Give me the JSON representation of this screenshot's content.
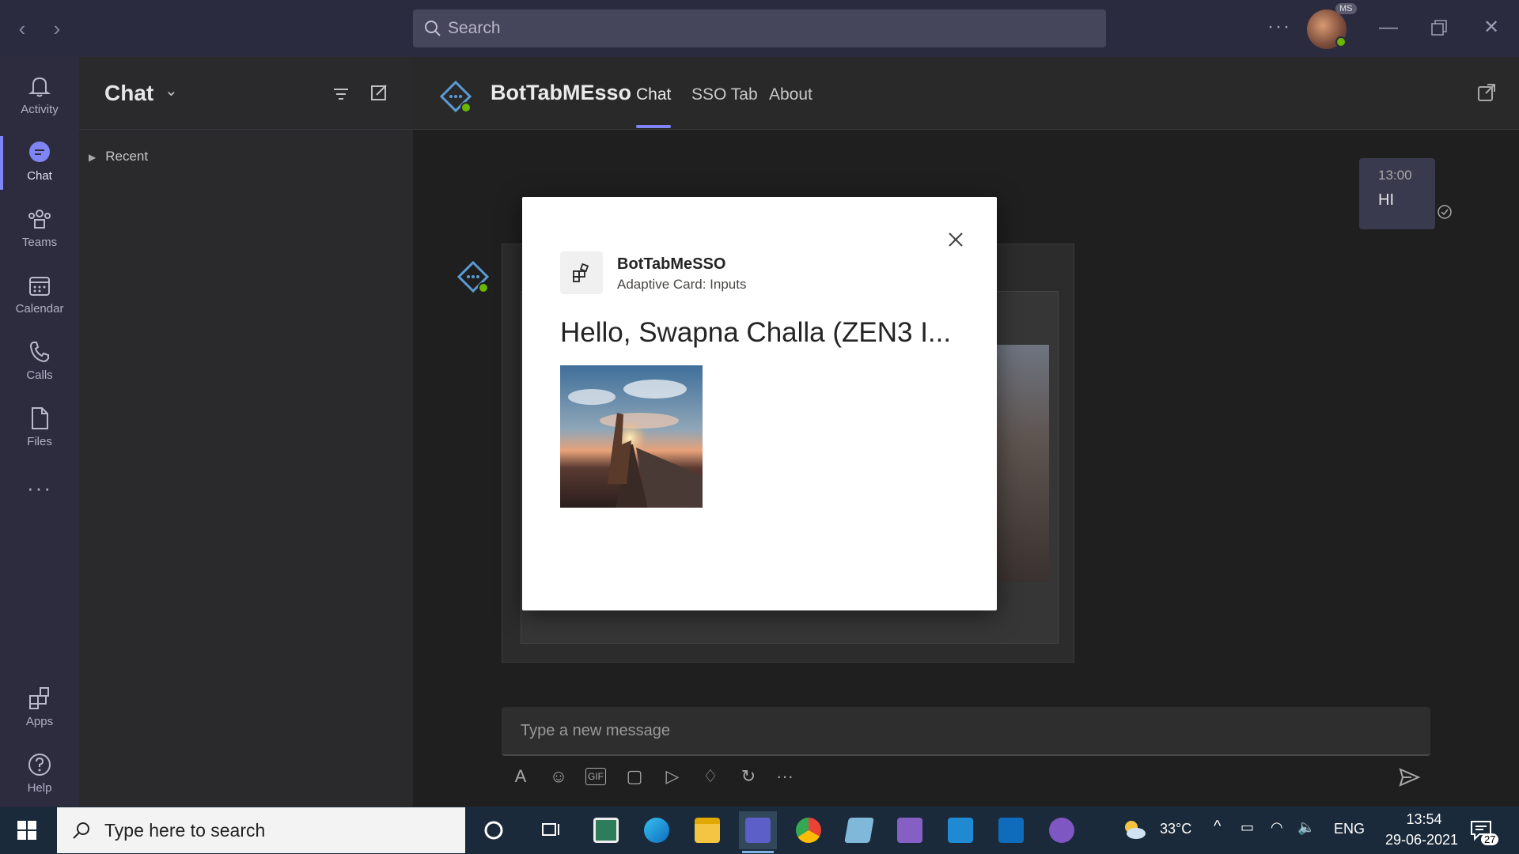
{
  "titlebar": {
    "search_placeholder": "Search",
    "avatar_badge": "MS",
    "more": "···"
  },
  "rail": {
    "items": [
      {
        "label": "Activity",
        "icon": "bell-icon"
      },
      {
        "label": "Chat",
        "icon": "chat-icon",
        "active": true
      },
      {
        "label": "Teams",
        "icon": "teams-icon"
      },
      {
        "label": "Calendar",
        "icon": "calendar-icon"
      },
      {
        "label": "Calls",
        "icon": "phone-icon"
      },
      {
        "label": "Files",
        "icon": "file-icon"
      },
      {
        "label": "Apps",
        "icon": "apps-icon"
      },
      {
        "label": "Help",
        "icon": "help-icon"
      }
    ],
    "more": "···"
  },
  "chatpane": {
    "title": "Chat",
    "recent": "Recent"
  },
  "main": {
    "bot_title": "BotTabMEsso",
    "tabs": [
      {
        "label": "Chat",
        "active": true
      },
      {
        "label": "SSO Tab"
      },
      {
        "label": "About"
      }
    ],
    "message": {
      "time": "13:00",
      "text": "HI"
    },
    "composer_placeholder": "Type a new message"
  },
  "modal": {
    "app_name": "BotTabMeSSO",
    "subtitle": "Adaptive Card: Inputs",
    "greeting": "Hello, Swapna Challa (ZEN3 I..."
  },
  "taskbar": {
    "search_placeholder": "Type here to search",
    "weather": "33°C",
    "language": "ENG",
    "time": "13:54",
    "date": "29-06-2021",
    "notifications": "27"
  },
  "colors": {
    "accent": "#7f85f5",
    "titlebar": "#2b2b40",
    "rail": "#2d2c3f",
    "online": "#6bb700"
  }
}
